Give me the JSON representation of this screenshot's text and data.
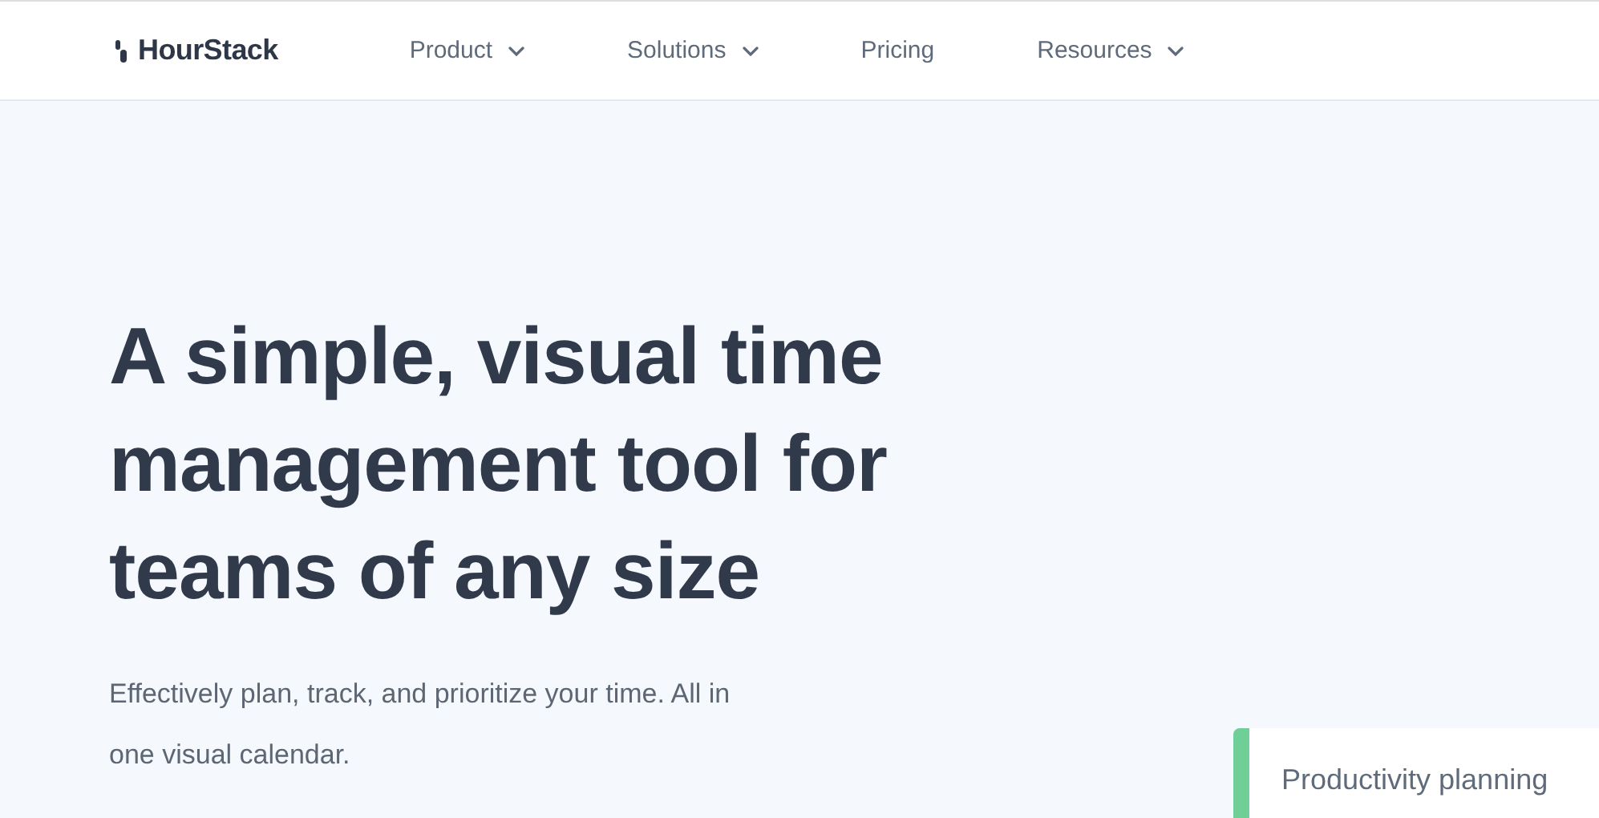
{
  "header": {
    "logo": "HourStack",
    "nav": [
      {
        "label": "Product",
        "has_menu": true
      },
      {
        "label": "Solutions",
        "has_menu": true
      },
      {
        "label": "Pricing",
        "has_menu": false
      },
      {
        "label": "Resources",
        "has_menu": true
      }
    ]
  },
  "hero": {
    "heading": "A simple, visual time management tool for teams of any size",
    "subtitle": "Effectively plan, track, and prioritize your time. All in one visual calendar."
  },
  "card": {
    "title": "Productivity planning",
    "color": "#6fcf97"
  }
}
